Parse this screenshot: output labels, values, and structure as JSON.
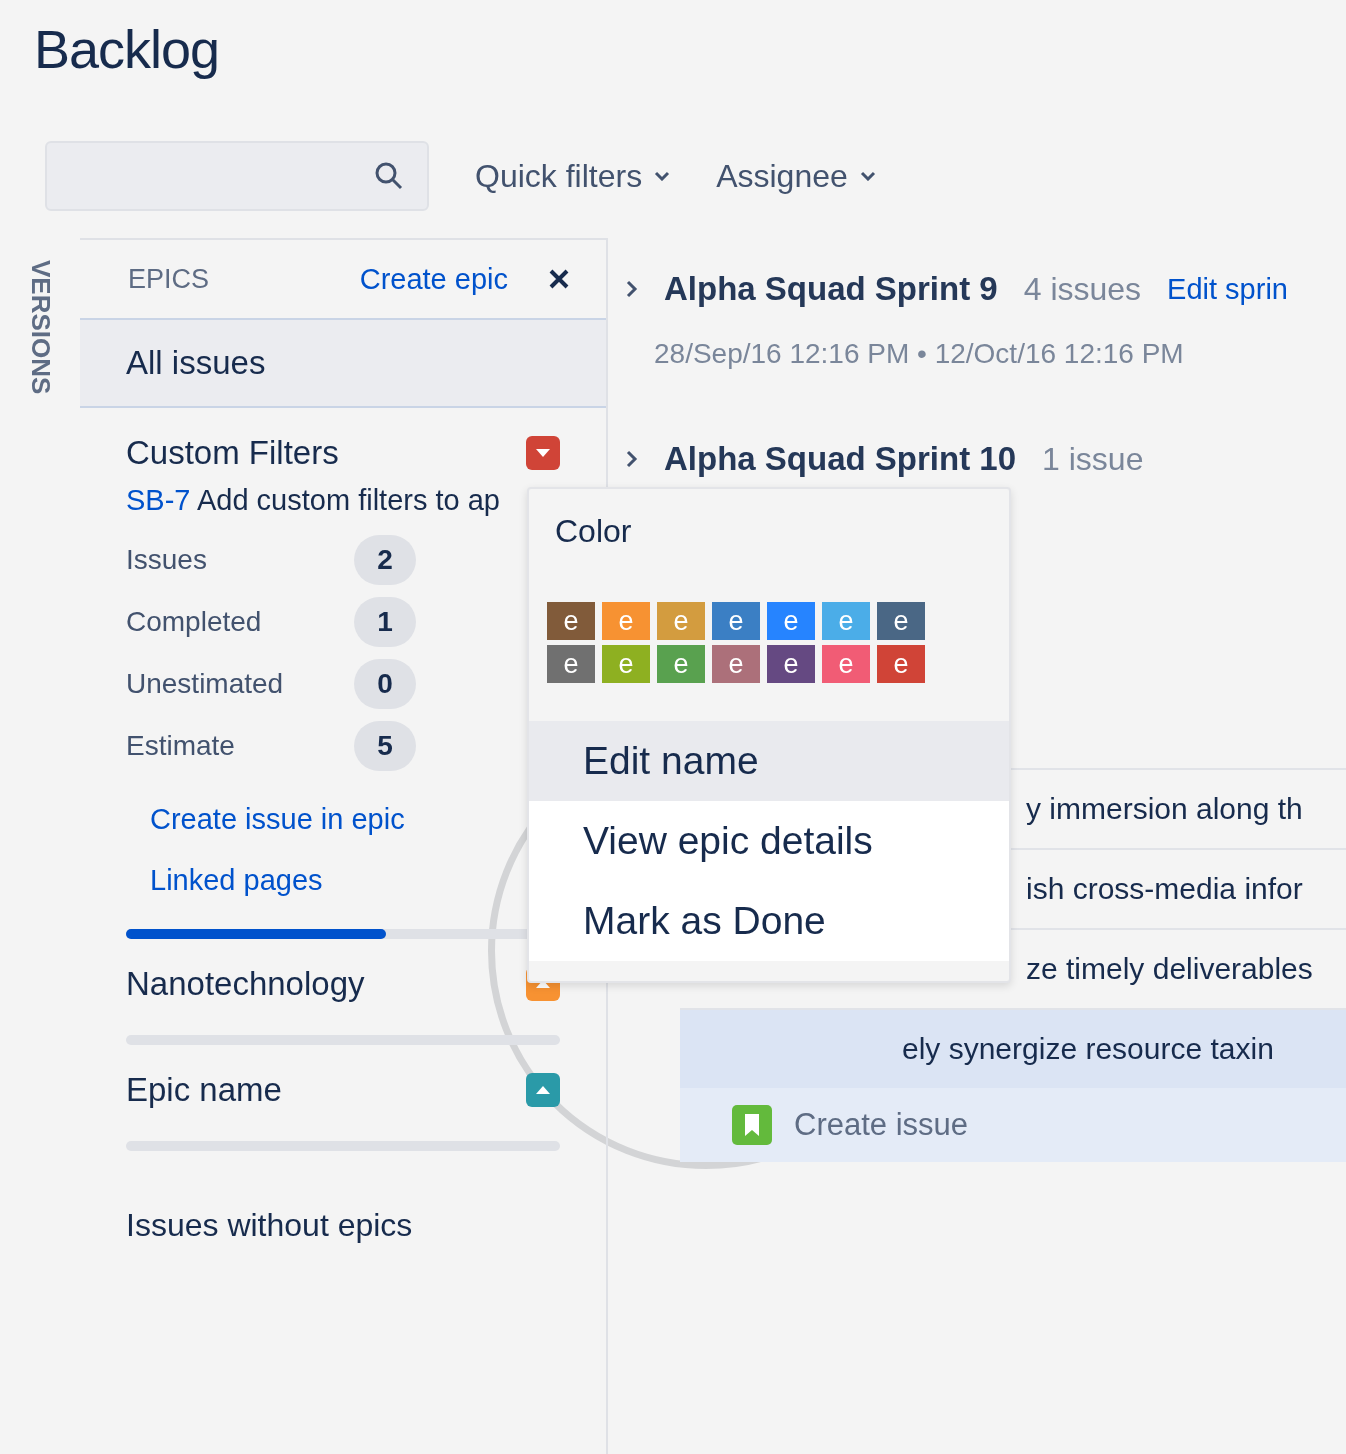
{
  "title": "Backlog",
  "toolbar": {
    "filters": [
      {
        "label": "Quick filters"
      },
      {
        "label": "Assignee"
      }
    ]
  },
  "versions_tab": {
    "label": "VERSIONS"
  },
  "epics_panel": {
    "heading": "EPICS",
    "create_link": "Create epic",
    "all_issues": {
      "label": "All issues"
    },
    "epics": [
      {
        "name": "Custom Filters",
        "color": "#d04437",
        "expanded": true,
        "issue_key": "SB-7",
        "issue_summary": "Add custom filters to ap",
        "stats": [
          {
            "label": "Issues",
            "value": "2"
          },
          {
            "label": "Completed",
            "value": "1"
          },
          {
            "label": "Unestimated",
            "value": "0"
          },
          {
            "label": "Estimate",
            "value": "5"
          }
        ],
        "links": [
          "Create issue in epic",
          "Linked pages"
        ],
        "level": 0.6
      },
      {
        "name": "Nanotechnology",
        "color": "#f79232",
        "expanded": false
      },
      {
        "name": "Epic name",
        "color": "#2a9aa8",
        "expanded": false
      }
    ],
    "issues_without_epics": "Issues without epics"
  },
  "sprints": [
    {
      "name": "Alpha Squad Sprint 9",
      "count": "4 issues",
      "edit_link": "Edit sprin",
      "dates": "28/Sep/16 12:16 PM • 12/Oct/16 12:16 PM"
    },
    {
      "name": "Alpha Squad Sprint 10",
      "count": "1 issue"
    }
  ],
  "issue_rows": [
    {
      "summary": "y immersion along th",
      "selected": false
    },
    {
      "summary": "ish cross-media infor",
      "selected": false
    },
    {
      "summary": "ze timely deliverables",
      "selected": false
    },
    {
      "summary": "ely synergize resource taxin",
      "selected": true
    }
  ],
  "create_issue": "Create issue",
  "epic_menu": {
    "color_heading": "Color",
    "swatches": [
      {
        "label": "e",
        "color": "#815b3a"
      },
      {
        "label": "e",
        "color": "#f79232"
      },
      {
        "label": "e",
        "color": "#d39c3f"
      },
      {
        "label": "e",
        "color": "#3b7fc4"
      },
      {
        "label": "e",
        "color": "#2684ff"
      },
      {
        "label": "e",
        "color": "#4bade8"
      },
      {
        "label": "e",
        "color": "#4a6785"
      },
      {
        "label": "e",
        "color": "#707070"
      },
      {
        "label": "e",
        "color": "#8eb021"
      },
      {
        "label": "e",
        "color": "#59a14f"
      },
      {
        "label": "e",
        "color": "#ac707a"
      },
      {
        "label": "e",
        "color": "#654982"
      },
      {
        "label": "e",
        "color": "#f15c75"
      },
      {
        "label": "e",
        "color": "#d04437"
      }
    ],
    "items": [
      {
        "label": "Edit name",
        "selected": true
      },
      {
        "label": "View epic details",
        "selected": false
      },
      {
        "label": "Mark as Done",
        "selected": false
      }
    ]
  }
}
